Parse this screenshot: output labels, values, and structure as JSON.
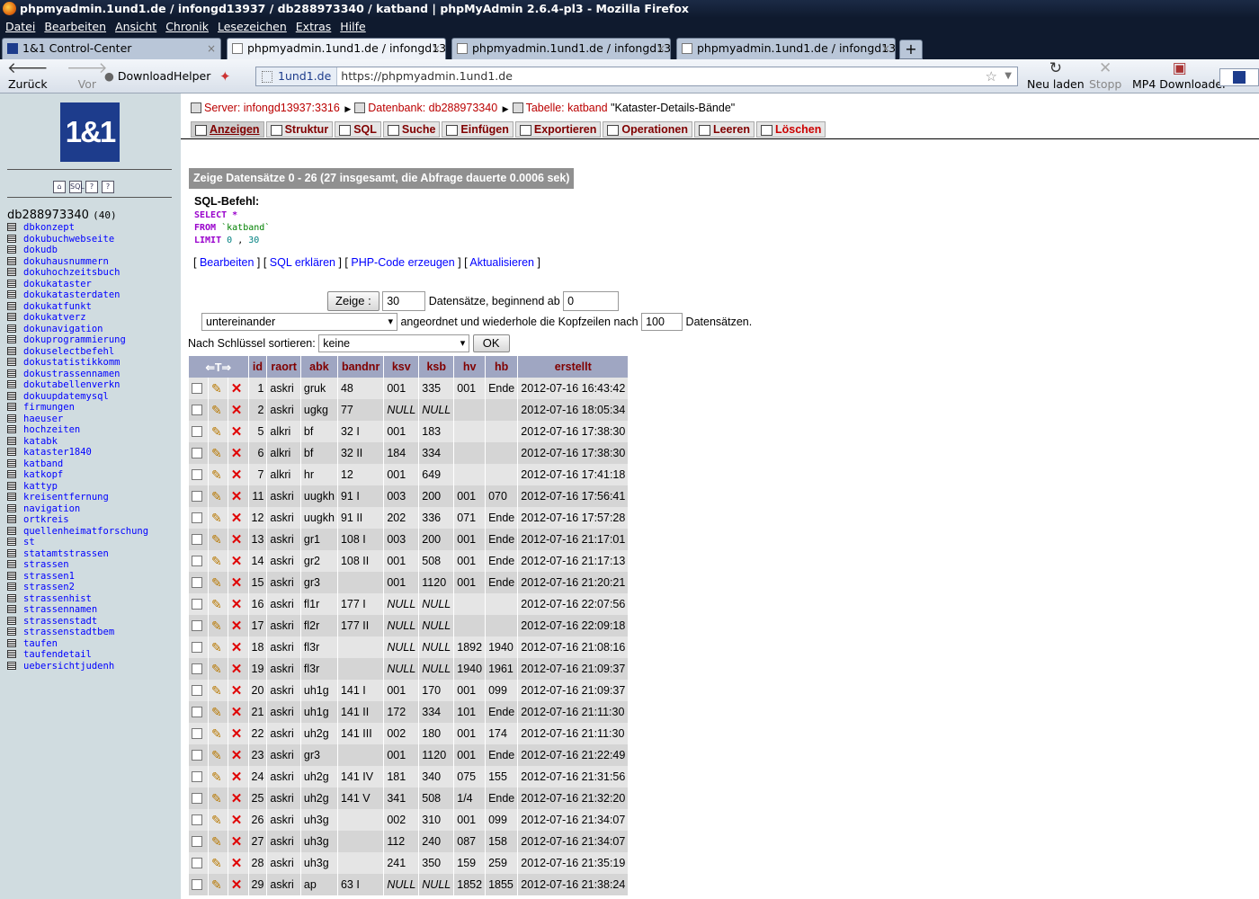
{
  "window_title": "phpmyadmin.1und1.de / infongd13937 / db288973340 / katband | phpMyAdmin 2.6.4-pl3 - Mozilla Firefox",
  "menu": [
    "Datei",
    "Bearbeiten",
    "Ansicht",
    "Chronik",
    "Lesezeichen",
    "Extras",
    "Hilfe"
  ],
  "browser_tabs": [
    {
      "label": "1&1 Control-Center"
    },
    {
      "label": "phpmyadmin.1und1.de / infongd139..."
    },
    {
      "label": "phpmyadmin.1und1.de / infongd139..."
    },
    {
      "label": "phpmyadmin.1und1.de / infongd139..."
    }
  ],
  "toolbar": {
    "back": "Zurück",
    "forward": "Vor",
    "downloadhelper": "DownloadHelper",
    "reload": "Neu laden",
    "stop": "Stopp",
    "mp4": "MP4 Downloader",
    "site": "1und1.de",
    "url": "https://phpmyadmin.1und1.de"
  },
  "sidebar": {
    "logo": "1&1",
    "db": "db288973340",
    "db_count": "(40)",
    "tables": [
      "dbkonzept",
      "dokubuchwebseite",
      "dokudb",
      "dokuhausnummern",
      "dokuhochzeitsbuch",
      "dokukataster",
      "dokukatasterdaten",
      "dokukatfunkt",
      "dokukatverz",
      "dokunavigation",
      "dokuprogrammierung",
      "dokuselectbefehl",
      "dokustatistikkomm",
      "dokustrassennamen",
      "dokutabellenverkn",
      "dokuupdatemysql",
      "firmungen",
      "haeuser",
      "hochzeiten",
      "katabk",
      "kataster1840",
      "katband",
      "katkopf",
      "kattyp",
      "kreisentfernung",
      "navigation",
      "ortkreis",
      "quellenheimatforschung",
      "st",
      "statamtstrassen",
      "strassen",
      "strassen1",
      "strassen2",
      "strassenhist",
      "strassennamen",
      "strassenstadt",
      "strassenstadtbem",
      "taufen",
      "taufendetail",
      "uebersichtjudenh"
    ]
  },
  "breadcrumb": {
    "server_label": "Server:",
    "server": "infongd13937:3316",
    "db_label": "Datenbank:",
    "db": "db288973340",
    "table_label": "Tabelle:",
    "table": "katband",
    "comment": "\"Kataster-Details-Bände\""
  },
  "tabs": [
    "Anzeigen",
    "Struktur",
    "SQL",
    "Suche",
    "Einfügen",
    "Exportieren",
    "Operationen",
    "Leeren",
    "Löschen"
  ],
  "result_banner": "Zeige Datensätze 0 - 26 (27 insgesamt, die Abfrage dauerte 0.0006 sek)",
  "sql": {
    "label": "SQL-Befehl:",
    "select": "SELECT",
    "star": "*",
    "from": "FROM",
    "table": "`katband`",
    "limit": "LIMIT",
    "limit_a": "0",
    "comma": ",",
    "limit_b": "30"
  },
  "sql_links": [
    "Bearbeiten",
    "SQL erklären",
    "PHP-Code erzeugen",
    "Aktualisieren"
  ],
  "controls": {
    "show_btn": "Zeige :",
    "rows": "30",
    "rows_text": "Datensätze, beginnend ab",
    "start": "0",
    "mode": "untereinander",
    "mode_text": "angeordnet und wiederhole die Kopfzeilen nach",
    "repeat": "100",
    "repeat_text": "Datensätzen.",
    "sort_label": "Nach Schlüssel sortieren:",
    "sort_value": "keine",
    "ok": "OK"
  },
  "columns": [
    "id",
    "raort",
    "abk",
    "bandnr",
    "ksv",
    "ksb",
    "hv",
    "hb",
    "erstellt"
  ],
  "rows": [
    [
      "1",
      "askri",
      "gruk",
      "48",
      "001",
      "335",
      "001",
      "Ende",
      "2012-07-16 16:43:42"
    ],
    [
      "2",
      "askri",
      "ugkg",
      "77",
      "NULL",
      "NULL",
      "",
      "",
      "2012-07-16 18:05:34"
    ],
    [
      "5",
      "alkri",
      "bf",
      "32 I",
      "001",
      "183",
      "",
      "",
      "2012-07-16 17:38:30"
    ],
    [
      "6",
      "alkri",
      "bf",
      "32 II",
      "184",
      "334",
      "",
      "",
      "2012-07-16 17:38:30"
    ],
    [
      "7",
      "alkri",
      "hr",
      "12",
      "001",
      "649",
      "",
      "",
      "2012-07-16 17:41:18"
    ],
    [
      "11",
      "askri",
      "uugkh",
      "91 I",
      "003",
      "200",
      "001",
      "070",
      "2012-07-16 17:56:41"
    ],
    [
      "12",
      "askri",
      "uugkh",
      "91 II",
      "202",
      "336",
      "071",
      "Ende",
      "2012-07-16 17:57:28"
    ],
    [
      "13",
      "askri",
      "gr1",
      "108 I",
      "003",
      "200",
      "001",
      "Ende",
      "2012-07-16 21:17:01"
    ],
    [
      "14",
      "askri",
      "gr2",
      "108 II",
      "001",
      "508",
      "001",
      "Ende",
      "2012-07-16 21:17:13"
    ],
    [
      "15",
      "askri",
      "gr3",
      "",
      "001",
      "1120",
      "001",
      "Ende",
      "2012-07-16 21:20:21"
    ],
    [
      "16",
      "askri",
      "fl1r",
      "177 I",
      "NULL",
      "NULL",
      "",
      "",
      "2012-07-16 22:07:56"
    ],
    [
      "17",
      "askri",
      "fl2r",
      "177 II",
      "NULL",
      "NULL",
      "",
      "",
      "2012-07-16 22:09:18"
    ],
    [
      "18",
      "askri",
      "fl3r",
      "",
      "NULL",
      "NULL",
      "1892",
      "1940",
      "2012-07-16 21:08:16"
    ],
    [
      "19",
      "askri",
      "fl3r",
      "",
      "NULL",
      "NULL",
      "1940",
      "1961",
      "2012-07-16 21:09:37"
    ],
    [
      "20",
      "askri",
      "uh1g",
      "141 I",
      "001",
      "170",
      "001",
      "099",
      "2012-07-16 21:09:37"
    ],
    [
      "21",
      "askri",
      "uh1g",
      "141 II",
      "172",
      "334",
      "101",
      "Ende",
      "2012-07-16 21:11:30"
    ],
    [
      "22",
      "askri",
      "uh2g",
      "141 III",
      "002",
      "180",
      "001",
      "174",
      "2012-07-16 21:11:30"
    ],
    [
      "23",
      "askri",
      "gr3",
      "",
      "001",
      "1120",
      "001",
      "Ende",
      "2012-07-16 21:22:49"
    ],
    [
      "24",
      "askri",
      "uh2g",
      "141 IV",
      "181",
      "340",
      "075",
      "155",
      "2012-07-16 21:31:56"
    ],
    [
      "25",
      "askri",
      "uh2g",
      "141 V",
      "341",
      "508",
      "1/4",
      "Ende",
      "2012-07-16 21:32:20"
    ],
    [
      "26",
      "askri",
      "uh3g",
      "",
      "002",
      "310",
      "001",
      "099",
      "2012-07-16 21:34:07"
    ],
    [
      "27",
      "askri",
      "uh3g",
      "",
      "112",
      "240",
      "087",
      "158",
      "2012-07-16 21:34:07"
    ],
    [
      "28",
      "askri",
      "uh3g",
      "",
      "241",
      "350",
      "159",
      "259",
      "2012-07-16 21:35:19"
    ],
    [
      "29",
      "askri",
      "ap",
      "63 I",
      "NULL",
      "NULL",
      "1852",
      "1855",
      "2012-07-16 21:38:24"
    ]
  ]
}
